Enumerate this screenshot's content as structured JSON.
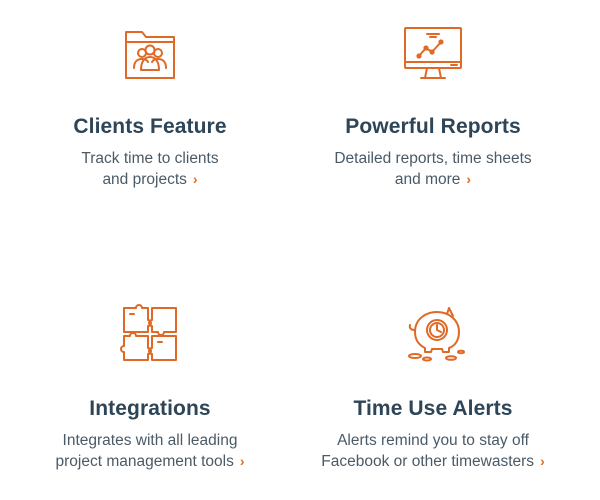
{
  "accent_color": "#e06a25",
  "title_color": "#2d4557",
  "text_color": "#4a5a66",
  "features": [
    {
      "icon": "folder-users-icon",
      "title": "Clients Feature",
      "desc_line1": "Track time to clients",
      "desc_line2": "and projects",
      "chevron": "›"
    },
    {
      "icon": "monitor-chart-icon",
      "title": "Powerful Reports",
      "desc_line1": "Detailed reports, time sheets",
      "desc_line2": "and more",
      "chevron": "›"
    },
    {
      "icon": "puzzle-icon",
      "title": "Integrations",
      "desc_line1": "Integrates with all leading",
      "desc_line2": "project management tools",
      "chevron": "›"
    },
    {
      "icon": "piggy-clock-icon",
      "title": "Time Use Alerts",
      "desc_line1": "Alerts remind you to stay off",
      "desc_line2": "Facebook or other timewasters",
      "chevron": "›"
    }
  ]
}
